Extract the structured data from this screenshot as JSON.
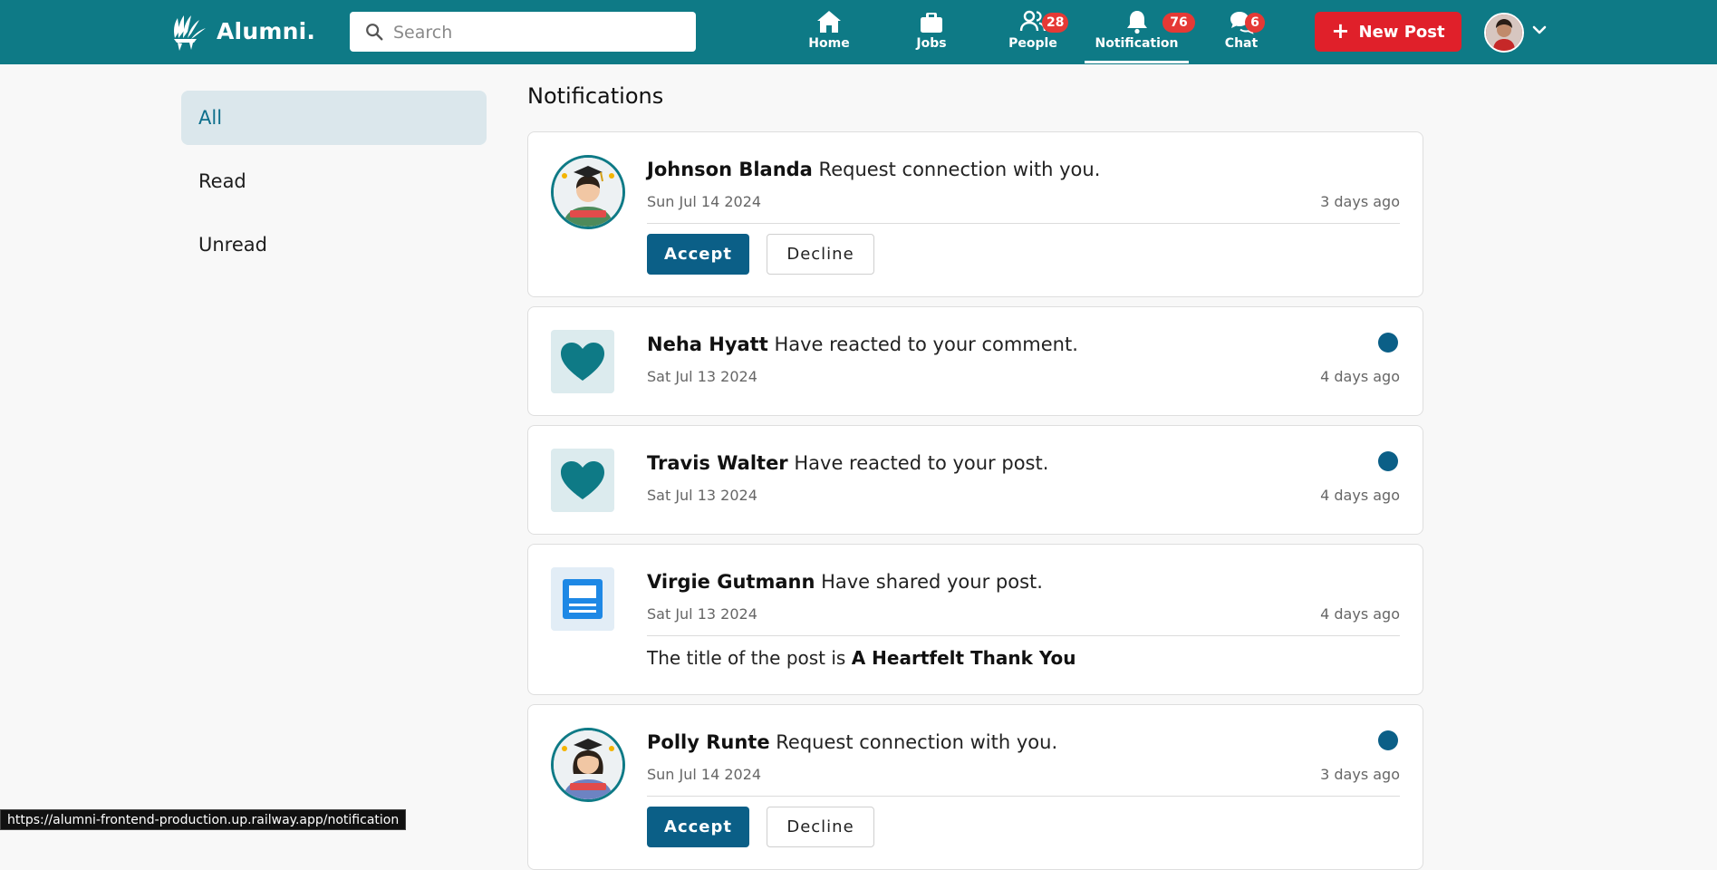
{
  "header": {
    "brand": "Alumni.",
    "search": {
      "placeholder": "Search",
      "value": ""
    },
    "nav": [
      {
        "label": "Home",
        "icon": "home-icon",
        "badge": ""
      },
      {
        "label": "Jobs",
        "icon": "briefcase-icon",
        "badge": ""
      },
      {
        "label": "People",
        "icon": "people-icon",
        "badge": "28"
      },
      {
        "label": "Notification",
        "icon": "bell-icon",
        "badge": "76",
        "active": true
      },
      {
        "label": "Chat",
        "icon": "chat-icon",
        "badge": "6"
      }
    ],
    "new_post_label": "New Post",
    "colors": {
      "header_bg": "#0e7a86",
      "new_post_bg": "#e0202a",
      "badge_bg": "#e53935"
    }
  },
  "sidebar": {
    "items": [
      {
        "label": "All",
        "active": true
      },
      {
        "label": "Read"
      },
      {
        "label": "Unread"
      }
    ]
  },
  "main": {
    "title": "Notifications",
    "notifications": [
      {
        "name": "Johnson Blanda",
        "message": "Request connection with you.",
        "date": "Sun Jul 14 2024",
        "ago": "3 days ago",
        "icon": "avatar-male-graduate",
        "unread": false,
        "accept_label": "Accept",
        "decline_label": "Decline"
      },
      {
        "name": "Neha Hyatt",
        "message": "Have reacted to your comment.",
        "date": "Sat Jul 13 2024",
        "ago": "4 days ago",
        "icon": "heart-icon",
        "unread": true
      },
      {
        "name": "Travis Walter",
        "message": "Have reacted to your post.",
        "date": "Sat Jul 13 2024",
        "ago": "4 days ago",
        "icon": "heart-icon",
        "unread": true
      },
      {
        "name": "Virgie Gutmann",
        "message": "Have shared your post.",
        "date": "Sat Jul 13 2024",
        "ago": "4 days ago",
        "icon": "document-icon",
        "unread": false,
        "post_title_prefix": "The title of the post is",
        "post_title": "A Heartfelt Thank You"
      },
      {
        "name": "Polly Runte",
        "message": "Request connection with you.",
        "date": "Sun Jul 14 2024",
        "ago": "3 days ago",
        "icon": "avatar-female-graduate",
        "unread": true,
        "accept_label": "Accept",
        "decline_label": "Decline"
      }
    ]
  },
  "status_bar": {
    "url": "https://alumni-frontend-production.up.railway.app/notification"
  }
}
